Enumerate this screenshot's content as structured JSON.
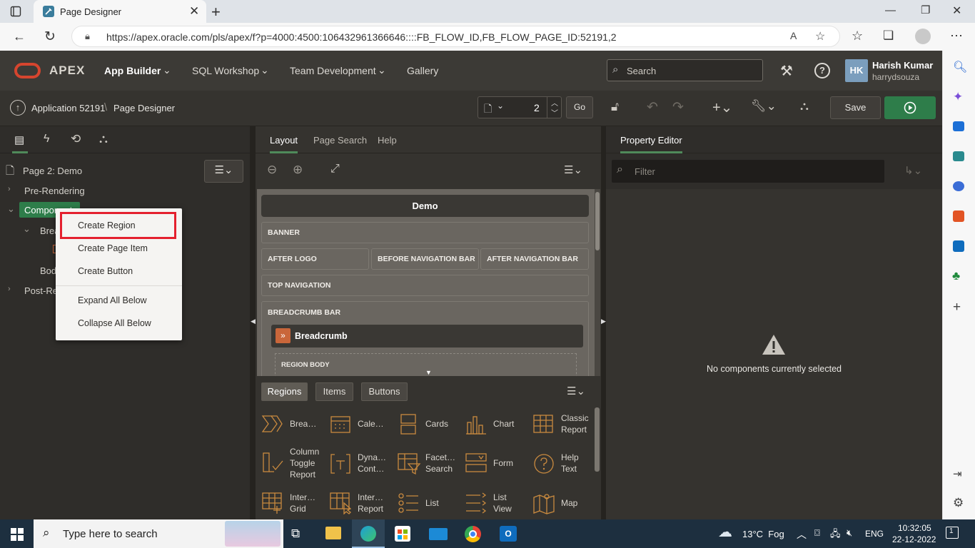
{
  "browser": {
    "tab_title": "Page Designer",
    "url": "https://apex.oracle.com/pls/apex/f?p=4000:4500:106432961366646::::FB_FLOW_ID,FB_FLOW_PAGE_ID:52191,2"
  },
  "header": {
    "logo_text": "APEX",
    "menus": [
      "App Builder",
      "SQL Workshop",
      "Team Development",
      "Gallery"
    ],
    "search_placeholder": "Search",
    "user_initials": "HK",
    "user_name": "Harish Kumar",
    "user_login": "harrydsouza"
  },
  "toolbar": {
    "app_crumb": "Application 52191",
    "page_crumb": "Page Designer",
    "page_number": "2",
    "go_label": "Go",
    "save_label": "Save"
  },
  "left_pane": {
    "page_title": "Page 2: Demo",
    "tree": [
      "Pre-Rendering",
      "Components",
      "Brea",
      "Body",
      "Post-Re"
    ]
  },
  "context_menu": {
    "items": [
      "Create Region",
      "Create Page Item",
      "Create Button",
      "Expand All Below",
      "Collapse All Below"
    ]
  },
  "mid_pane": {
    "tabs": [
      "Layout",
      "Page Search",
      "Help"
    ],
    "page_name": "Demo",
    "slots": {
      "banner": "BANNER",
      "after_logo": "AFTER LOGO",
      "before_nav": "BEFORE NAVIGATION BAR",
      "after_nav": "AFTER NAVIGATION BAR",
      "top_nav": "TOP NAVIGATION",
      "breadcrumb_bar": "BREADCRUMB BAR",
      "region_body": "REGION BODY"
    },
    "breadcrumb_region": "Breadcrumb",
    "gallery_tabs": [
      "Regions",
      "Items",
      "Buttons"
    ],
    "gallery_items": [
      {
        "label": "Brea…",
        "icon": "breadcrumb-icon"
      },
      {
        "label": "Cale…",
        "icon": "calendar-icon"
      },
      {
        "label": "Cards",
        "icon": "cards-icon"
      },
      {
        "label": "Chart",
        "icon": "chart-icon"
      },
      {
        "label": "Classic Report",
        "icon": "classic-report-icon"
      },
      {
        "label": "Column Toggle Report",
        "icon": "column-toggle-icon"
      },
      {
        "label": "Dyna… Cont…",
        "icon": "dynamic-content-icon"
      },
      {
        "label": "Facet… Search",
        "icon": "faceted-search-icon"
      },
      {
        "label": "Form",
        "icon": "form-icon"
      },
      {
        "label": "Help Text",
        "icon": "help-icon"
      },
      {
        "label": "Inter… Grid",
        "icon": "interactive-grid-icon"
      },
      {
        "label": "Inter… Report",
        "icon": "interactive-report-icon"
      },
      {
        "label": "List",
        "icon": "list-icon"
      },
      {
        "label": "List View",
        "icon": "list-view-icon"
      },
      {
        "label": "Map",
        "icon": "map-icon"
      }
    ]
  },
  "right_pane": {
    "tab": "Property Editor",
    "filter_placeholder": "Filter",
    "empty_message": "No components currently selected"
  },
  "taskbar": {
    "search_placeholder": "Type here to search",
    "weather": "13°C  Fog",
    "lang": "ENG",
    "time": "10:32:05",
    "date": "22-12-2022",
    "notifications": "1"
  },
  "colors": {
    "accent_green": "#2e7d4a",
    "icon_orange": "#c98a3f",
    "highlight_red": "#e4202e"
  }
}
